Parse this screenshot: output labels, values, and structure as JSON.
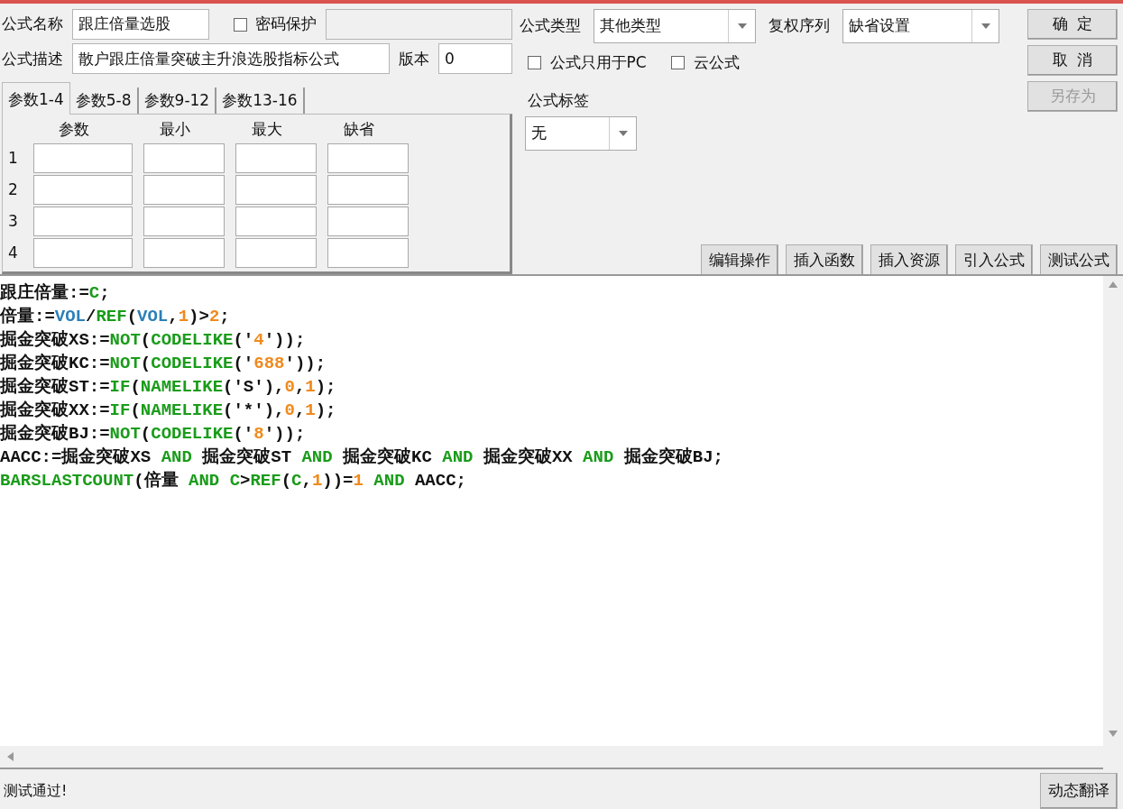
{
  "formula": {
    "name_label": "公式名称",
    "name_value": "跟庄倍量选股",
    "password": {
      "label": "密码保护",
      "checked": false
    },
    "desc_label": "公式描述",
    "desc_value": "散户跟庄倍量突破主升浪选股指标公式",
    "version_label": "版本",
    "version_value": "0"
  },
  "params": {
    "tabs": [
      {
        "label": "参数1-4",
        "selected": true
      },
      {
        "label": "参数5-8",
        "selected": false
      },
      {
        "label": "参数9-12",
        "selected": false
      },
      {
        "label": "参数13-16",
        "selected": false
      }
    ],
    "columns": [
      "参数",
      "最小",
      "最大",
      "缺省"
    ],
    "rows": [
      {
        "index": "1"
      },
      {
        "index": "2"
      },
      {
        "index": "3"
      },
      {
        "index": "4"
      }
    ]
  },
  "type": {
    "label": "公式类型",
    "value": "其他类型"
  },
  "adjust": {
    "label": "复权序列",
    "value": "缺省设置"
  },
  "options": [
    {
      "label": "公式只用于PC",
      "checked": false
    },
    {
      "label": "云公式",
      "checked": false
    }
  ],
  "tag": {
    "label": "公式标签",
    "value": "无"
  },
  "side_buttons": [
    {
      "label": "确  定",
      "disabled": false
    },
    {
      "label": "取  消",
      "disabled": false
    },
    {
      "label": "另存为",
      "disabled": true
    }
  ],
  "tool_buttons": [
    "编辑操作",
    "插入函数",
    "插入资源",
    "引入公式",
    "测试公式"
  ],
  "code": [
    [
      {
        "kind": "text",
        "t": "跟庄倍量:="
      },
      {
        "kind": "func",
        "t": "C"
      },
      {
        "kind": "text",
        "t": ";"
      }
    ],
    [
      {
        "kind": "text",
        "t": "倍量:="
      },
      {
        "kind": "var",
        "t": "VOL"
      },
      {
        "kind": "text",
        "t": "/"
      },
      {
        "kind": "func",
        "t": "REF"
      },
      {
        "kind": "text",
        "t": "("
      },
      {
        "kind": "var",
        "t": "VOL"
      },
      {
        "kind": "text",
        "t": ","
      },
      {
        "kind": "num",
        "t": "1"
      },
      {
        "kind": "text",
        "t": ")>"
      },
      {
        "kind": "num",
        "t": "2"
      },
      {
        "kind": "text",
        "t": ";"
      }
    ],
    [
      {
        "kind": "text",
        "t": "掘金突破XS:="
      },
      {
        "kind": "func",
        "t": "NOT"
      },
      {
        "kind": "text",
        "t": "("
      },
      {
        "kind": "func",
        "t": "CODELIKE"
      },
      {
        "kind": "text",
        "t": "('"
      },
      {
        "kind": "num",
        "t": "4"
      },
      {
        "kind": "text",
        "t": "'));"
      }
    ],
    [
      {
        "kind": "text",
        "t": "掘金突破KC:="
      },
      {
        "kind": "func",
        "t": "NOT"
      },
      {
        "kind": "text",
        "t": "("
      },
      {
        "kind": "func",
        "t": "CODELIKE"
      },
      {
        "kind": "text",
        "t": "('"
      },
      {
        "kind": "num",
        "t": "688"
      },
      {
        "kind": "text",
        "t": "'));"
      }
    ],
    [
      {
        "kind": "text",
        "t": "掘金突破ST:="
      },
      {
        "kind": "func",
        "t": "IF"
      },
      {
        "kind": "text",
        "t": "("
      },
      {
        "kind": "func",
        "t": "NAMELIKE"
      },
      {
        "kind": "text",
        "t": "('S'),"
      },
      {
        "kind": "num",
        "t": "0"
      },
      {
        "kind": "text",
        "t": ","
      },
      {
        "kind": "num",
        "t": "1"
      },
      {
        "kind": "text",
        "t": ");"
      }
    ],
    [
      {
        "kind": "text",
        "t": "掘金突破XX:="
      },
      {
        "kind": "func",
        "t": "IF"
      },
      {
        "kind": "text",
        "t": "("
      },
      {
        "kind": "func",
        "t": "NAMELIKE"
      },
      {
        "kind": "text",
        "t": "('*'),"
      },
      {
        "kind": "num",
        "t": "0"
      },
      {
        "kind": "text",
        "t": ","
      },
      {
        "kind": "num",
        "t": "1"
      },
      {
        "kind": "text",
        "t": ");"
      }
    ],
    [
      {
        "kind": "text",
        "t": "掘金突破BJ:="
      },
      {
        "kind": "func",
        "t": "NOT"
      },
      {
        "kind": "text",
        "t": "("
      },
      {
        "kind": "func",
        "t": "CODELIKE"
      },
      {
        "kind": "text",
        "t": "('"
      },
      {
        "kind": "num",
        "t": "8"
      },
      {
        "kind": "text",
        "t": "'));"
      }
    ],
    [
      {
        "kind": "text",
        "t": "AACC:=掘金突破XS "
      },
      {
        "kind": "func",
        "t": "AND"
      },
      {
        "kind": "text",
        "t": " 掘金突破ST "
      },
      {
        "kind": "func",
        "t": "AND"
      },
      {
        "kind": "text",
        "t": " 掘金突破KC "
      },
      {
        "kind": "func",
        "t": "AND"
      },
      {
        "kind": "text",
        "t": " 掘金突破XX "
      },
      {
        "kind": "func",
        "t": "AND"
      },
      {
        "kind": "text",
        "t": " 掘金突破BJ;"
      }
    ],
    [
      {
        "kind": "func",
        "t": "BARSLASTCOUNT"
      },
      {
        "kind": "text",
        "t": "(倍量 "
      },
      {
        "kind": "func",
        "t": "AND C"
      },
      {
        "kind": "text",
        "t": ">"
      },
      {
        "kind": "func",
        "t": "REF"
      },
      {
        "kind": "text",
        "t": "("
      },
      {
        "kind": "func",
        "t": "C"
      },
      {
        "kind": "text",
        "t": ","
      },
      {
        "kind": "num",
        "t": "1"
      },
      {
        "kind": "text",
        "t": "))="
      },
      {
        "kind": "num",
        "t": "1"
      },
      {
        "kind": "func",
        "t": " AND"
      },
      {
        "kind": "text",
        "t": " AACC;"
      }
    ]
  ],
  "status": {
    "message": "测试通过!",
    "button": "动态翻译"
  }
}
